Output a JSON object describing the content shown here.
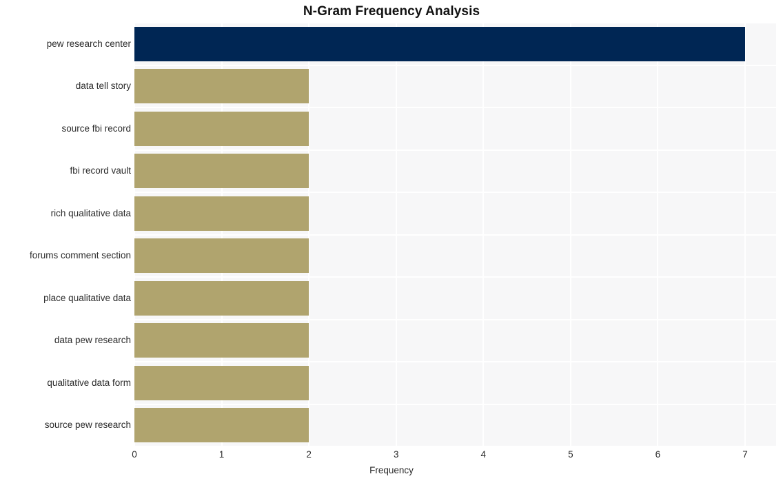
{
  "chart_data": {
    "type": "bar",
    "orientation": "horizontal",
    "title": "N-Gram Frequency Analysis",
    "xlabel": "Frequency",
    "ylabel": "",
    "categories": [
      "pew research center",
      "data tell story",
      "source fbi record",
      "fbi record vault",
      "rich qualitative data",
      "forums comment section",
      "place qualitative data",
      "data pew research",
      "qualitative data form",
      "source pew research"
    ],
    "values": [
      7,
      2,
      2,
      2,
      2,
      2,
      2,
      2,
      2,
      2
    ],
    "bar_colors": [
      "#002654",
      "#b0a46e",
      "#b0a46e",
      "#b0a46e",
      "#b0a46e",
      "#b0a46e",
      "#b0a46e",
      "#b0a46e",
      "#b0a46e",
      "#b0a46e"
    ],
    "xlim": [
      0,
      7
    ],
    "xticks": [
      0,
      1,
      2,
      3,
      4,
      5,
      6,
      7
    ],
    "xtick_labels": [
      "0",
      "1",
      "2",
      "3",
      "4",
      "5",
      "6",
      "7"
    ],
    "grid": true,
    "grid_color": "#ffffff",
    "plot_background": "#f7f7f8",
    "figure_background": "#ffffff",
    "legend": null,
    "highlight_color": "#002654",
    "default_color": "#b0a46e"
  }
}
